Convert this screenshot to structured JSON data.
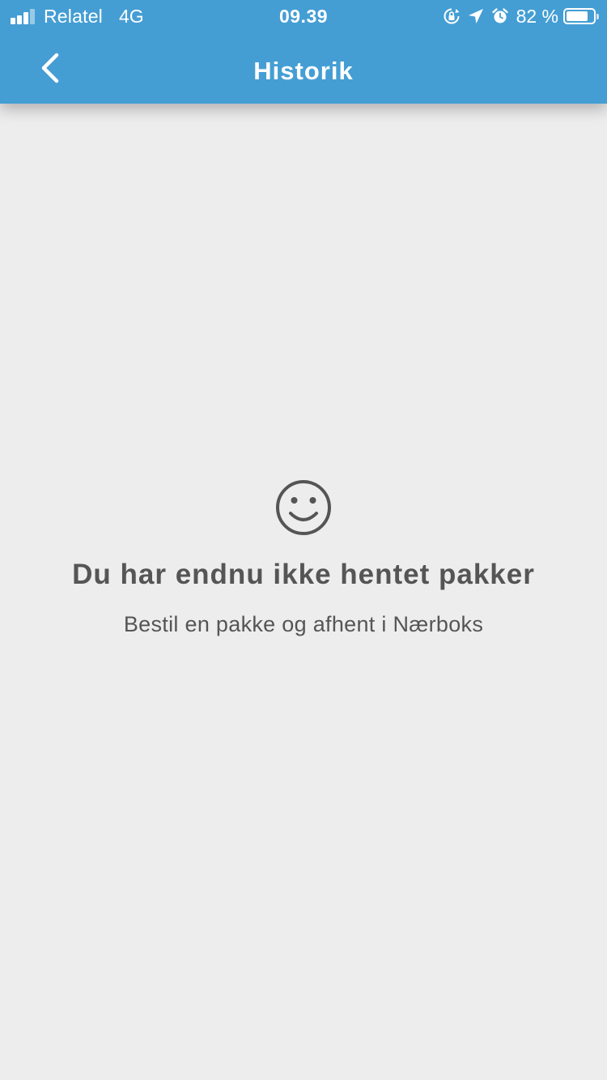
{
  "status_bar": {
    "carrier": "Relatel",
    "network": "4G",
    "time": "09.39",
    "battery_percent": "82 %",
    "battery_level": 0.82,
    "icons": [
      "signal-icon",
      "rotation-lock-icon",
      "location-arrow-icon",
      "alarm-icon",
      "battery-icon"
    ]
  },
  "header": {
    "title": "Historik",
    "back_icon": "chevron-left-icon"
  },
  "empty_state": {
    "icon": "smiley-icon",
    "title": "Du har endnu ikke hentet pakker",
    "subtitle": "Bestil en pakke og afhent i Nærboks"
  },
  "colors": {
    "header_background": "#449ed4",
    "page_background": "#ededed",
    "text": "#555555"
  }
}
